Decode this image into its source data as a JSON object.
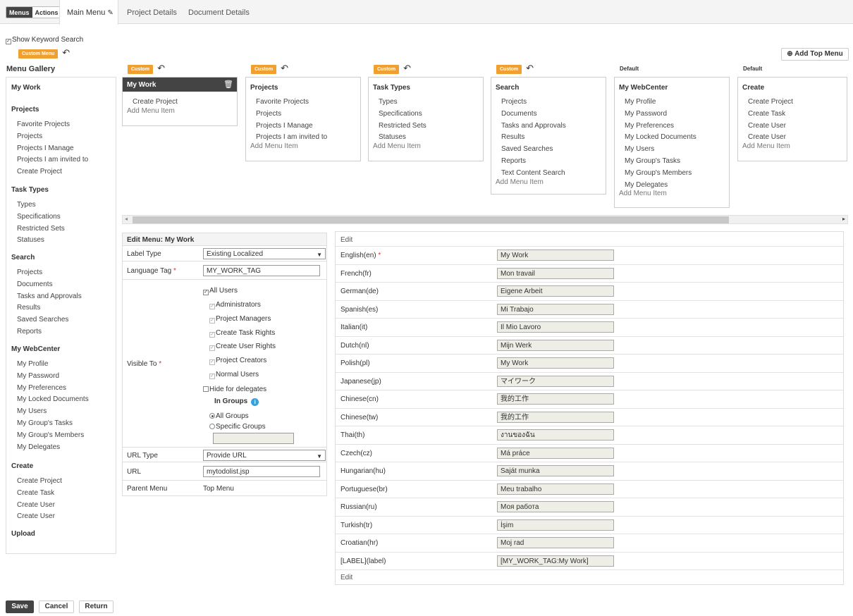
{
  "topbar": {
    "menus_label": "Menus",
    "actions_label": "Actions",
    "tabs": [
      "Main Menu",
      "Project Details",
      "Document Details"
    ]
  },
  "show_keyword_search": "Show Keyword Search",
  "custom_menu_badge": "Custom Menu",
  "add_top_menu": "Add Top Menu",
  "gallery": {
    "title": "Menu Gallery",
    "groups": [
      {
        "title": "My Work",
        "items": []
      },
      {
        "title": "Projects",
        "items": [
          "Favorite Projects",
          "Projects",
          "Projects I Manage",
          "Projects I am invited to",
          "Create Project"
        ]
      },
      {
        "title": "Task Types",
        "items": [
          "Types",
          "Specifications",
          "Restricted Sets",
          "Statuses"
        ]
      },
      {
        "title": "Search",
        "items": [
          "Projects",
          "Documents",
          "Tasks and Approvals",
          "Results",
          "Saved Searches",
          "Reports"
        ]
      },
      {
        "title": "My WebCenter",
        "items": [
          "My Profile",
          "My Password",
          "My Preferences",
          "My Locked Documents",
          "My Users",
          "My Group's Tasks",
          "My Group's Members",
          "My Delegates"
        ]
      },
      {
        "title": "Create",
        "items": [
          "Create Project",
          "Create Task",
          "Create User",
          "Create User"
        ]
      },
      {
        "title": "Upload",
        "items": []
      }
    ]
  },
  "top_menus": [
    {
      "label": "Custom",
      "title": "My Work",
      "items": [
        "Create Project"
      ],
      "add": "Add Menu Item"
    },
    {
      "label": "Custom",
      "title": "Projects",
      "items": [
        "Favorite Projects",
        "Projects",
        "Projects I Manage",
        "Projects I am invited to"
      ],
      "add": "Add Menu Item"
    },
    {
      "label": "Custom",
      "title": "Task Types",
      "items": [
        "Types",
        "Specifications",
        "Restricted Sets",
        "Statuses"
      ],
      "add": "Add Menu Item"
    },
    {
      "label": "Custom",
      "title": "Search",
      "items": [
        "Projects",
        "Documents",
        "Tasks and Approvals",
        "Results",
        "Saved Searches",
        "Reports",
        "Text Content Search"
      ],
      "add": "Add Menu Item"
    },
    {
      "label": "Default",
      "title": "My WebCenter",
      "items": [
        "My Profile",
        "My Password",
        "My Preferences",
        "My Locked Documents",
        "My Users",
        "My Group's Tasks",
        "My Group's Members",
        "My Delegates"
      ],
      "add": "Add Menu Item"
    },
    {
      "label": "Default",
      "title": "Create",
      "items": [
        "Create Project",
        "Create Task",
        "Create User",
        "Create User"
      ],
      "add": "Add Menu Item"
    }
  ],
  "edit": {
    "title": "Edit Menu: My Work",
    "label_type_label": "Label Type",
    "label_type_value": "Existing Localized",
    "language_tag_label": "Language Tag",
    "language_tag_value": "MY_WORK_TAG",
    "visible_to_label": "Visible To",
    "all_users": "All Users",
    "roles": [
      "Administrators",
      "Project Managers",
      "Create Task Rights",
      "Create User Rights",
      "Project Creators",
      "Normal Users"
    ],
    "hide_for_delegates": "Hide for delegates",
    "in_groups": "In Groups",
    "all_groups": "All Groups",
    "specific_groups": "Specific Groups",
    "url_type_label": "URL Type",
    "url_type_value": "Provide URL",
    "url_label": "URL",
    "url_value": "mytodolist.jsp",
    "parent_menu_label": "Parent Menu",
    "parent_menu_value": "Top Menu"
  },
  "localization": {
    "edit_top": "Edit",
    "edit_bottom": "Edit",
    "rows": [
      {
        "lang": "English(en)",
        "value": "My Work",
        "required": true
      },
      {
        "lang": "French(fr)",
        "value": "Mon travail"
      },
      {
        "lang": "German(de)",
        "value": "Eigene Arbeit"
      },
      {
        "lang": "Spanish(es)",
        "value": "Mi Trabajo"
      },
      {
        "lang": "Italian(it)",
        "value": "Il Mio Lavoro"
      },
      {
        "lang": "Dutch(nl)",
        "value": "Mijn Werk"
      },
      {
        "lang": "Polish(pl)",
        "value": "My Work"
      },
      {
        "lang": "Japanese(jp)",
        "value": "マイワーク"
      },
      {
        "lang": "Chinese(cn)",
        "value": "我的工作"
      },
      {
        "lang": "Chinese(tw)",
        "value": "我的工作"
      },
      {
        "lang": "Thai(th)",
        "value": "งานของฉัน"
      },
      {
        "lang": "Czech(cz)",
        "value": "Má práce"
      },
      {
        "lang": "Hungarian(hu)",
        "value": "Saját munka"
      },
      {
        "lang": "Portuguese(br)",
        "value": "Meu trabalho"
      },
      {
        "lang": "Russian(ru)",
        "value": "Моя работа"
      },
      {
        "lang": "Turkish(tr)",
        "value": "İşim"
      },
      {
        "lang": "Croatian(hr)",
        "value": "Moj rad"
      },
      {
        "lang": "[LABEL](label)",
        "value": "[MY_WORK_TAG:My Work]"
      }
    ]
  },
  "footer": {
    "save": "Save",
    "cancel": "Cancel",
    "return": "Return"
  }
}
